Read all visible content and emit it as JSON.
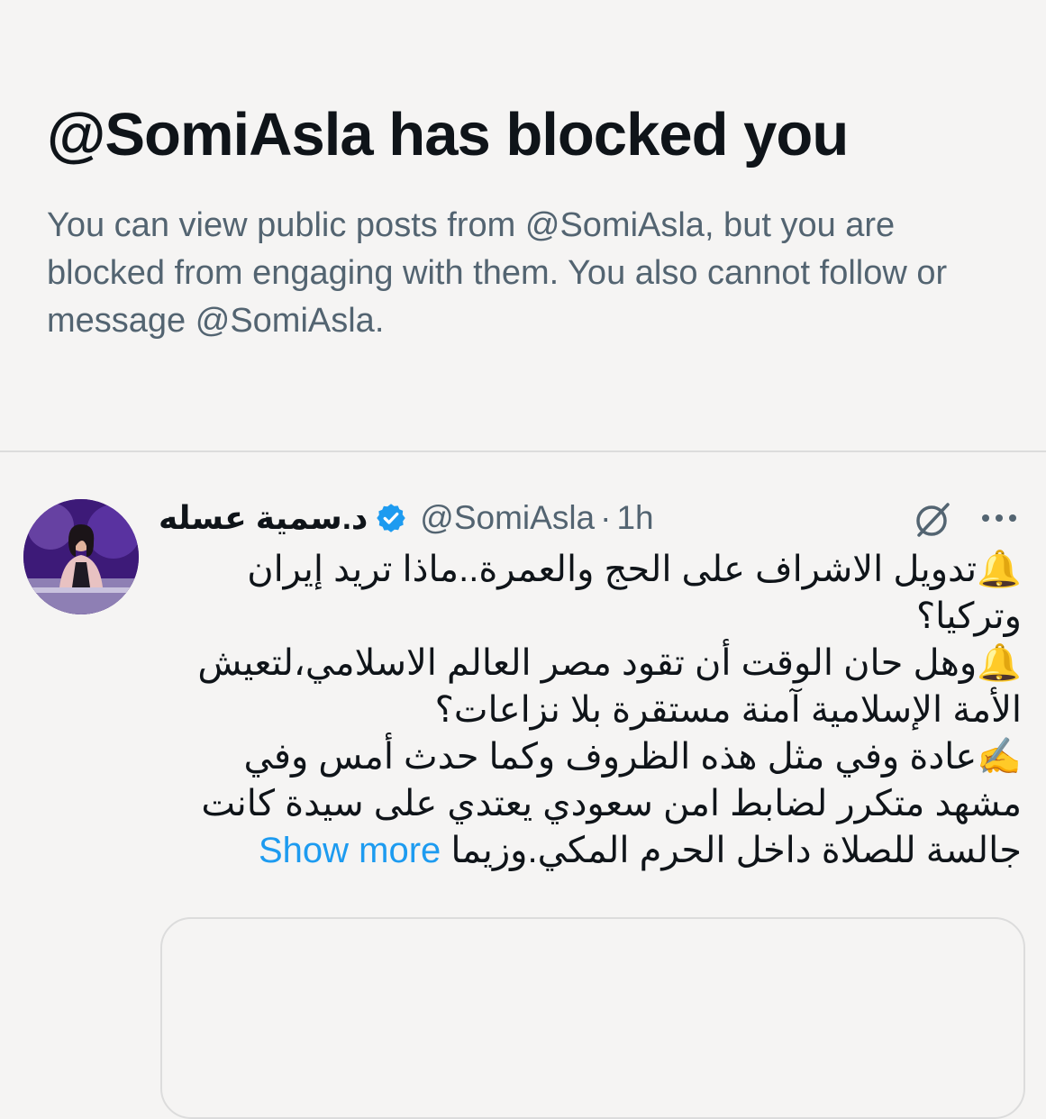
{
  "blocked": {
    "title": "@SomiAsla has blocked you",
    "description": "You can view public posts from @SomiAsla, but you are blocked from engaging with them. You also cannot follow or message @SomiAsla."
  },
  "tweet": {
    "display_name": "د.سمية عسله",
    "verified_icon": "verified-badge-icon",
    "handle": "@SomiAsla",
    "separator": "·",
    "time": "1h",
    "grok_icon": "grok-icon",
    "more_icon": "more-options-icon",
    "lines": [
      {
        "emoji": "🔔",
        "text": "تدويل الاشراف على الحج والعمرة..ماذا تريد إيران وتركيا؟"
      },
      {
        "emoji": "🔔",
        "text": "وهل حان الوقت أن تقود مصر العالم الاسلامي،لتعيش الأمة الإسلامية آمنة مستقرة بلا نزاعات؟"
      },
      {
        "emoji": "✍️",
        "text": "عادة وفي مثل هذه الظروف وكما حدث أمس وفي مشهد متكرر لضابط امن سعودي يعتدي على سيدة كانت جالسة للصلاة داخل الحرم المكي.وزيما"
      }
    ],
    "show_more": "Show more"
  },
  "colors": {
    "background": "#f5f4f3",
    "text_primary": "#0f1419",
    "text_secondary": "#536471",
    "link": "#1d9bf0",
    "verified": "#1d9bf0",
    "divider": "#dcdcdc"
  }
}
